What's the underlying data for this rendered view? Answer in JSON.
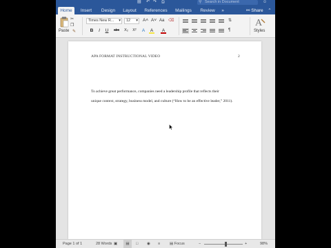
{
  "titlebar": {
    "search_placeholder": "Search in Document"
  },
  "tabs": [
    {
      "label": "Home",
      "active": true
    },
    {
      "label": "Insert"
    },
    {
      "label": "Design"
    },
    {
      "label": "Layout"
    },
    {
      "label": "References"
    },
    {
      "label": "Mailings"
    },
    {
      "label": "Review"
    }
  ],
  "share_label": "Share",
  "ribbon": {
    "paste_label": "Paste",
    "font_name": "Times New R...",
    "font_size": "12",
    "styles_label": "Styles",
    "bold": "B",
    "italic": "I",
    "underline": "U",
    "strike": "abc",
    "subscript": "X₂",
    "superscript": "X²",
    "grow": "A˄",
    "shrink": "A˅",
    "clear_format": "Aa",
    "highlight": "A",
    "font_color": "A",
    "highlight_color": "#f4e542",
    "font_color_value": "#c00000"
  },
  "document": {
    "running_head": "APA FORMAT INSTRUCTIONAL VIDEO",
    "page_number": "2",
    "body_lines": [
      "To achieve great performance, companies need a leadership profile that reflects their",
      "unique context, strategy, business model, and culture (“How to be an effective leader,” 2011)."
    ]
  },
  "statusbar": {
    "page": "Page 1 of 1",
    "words": "28 Words",
    "focus": "Focus",
    "zoom": "98%",
    "zoom_fraction": 0.55
  },
  "colors": {
    "accent": "#2b579a"
  }
}
